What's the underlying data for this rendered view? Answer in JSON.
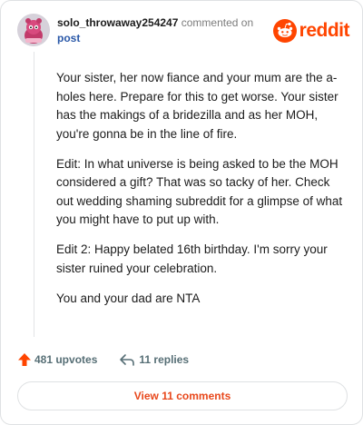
{
  "header": {
    "username": "solo_throwaway254247",
    "commented_on": "commented on",
    "post_link": "post",
    "brand": "reddit"
  },
  "comment": {
    "paragraphs": [
      "Your sister, her now fiance and your mum are the a-holes here. Prepare for this to get worse. Your sister has the makings of a bridezilla and as her MOH, you're gonna be in the line of fire.",
      "Edit: In what universe is being asked to be the MOH considered a gift? That was so tacky of her. Check out wedding shaming subreddit for a glimpse of what you might have to put up with.",
      "Edit 2: Happy belated 16th birthday. I'm sorry your sister ruined your celebration.",
      "You and your dad are NTA"
    ]
  },
  "actions": {
    "upvotes": "481 upvotes",
    "replies": "11 replies"
  },
  "view_comments": "View 11 comments",
  "colors": {
    "accent": "#ff4500",
    "link": "#2a58a8",
    "muted": "#576f76",
    "button_text": "#e8481c"
  },
  "icons": {
    "avatar": "snoo-avatar",
    "brand": "reddit-logo-icon",
    "upvote": "upvote-arrow-icon",
    "reply": "reply-arrow-icon"
  }
}
